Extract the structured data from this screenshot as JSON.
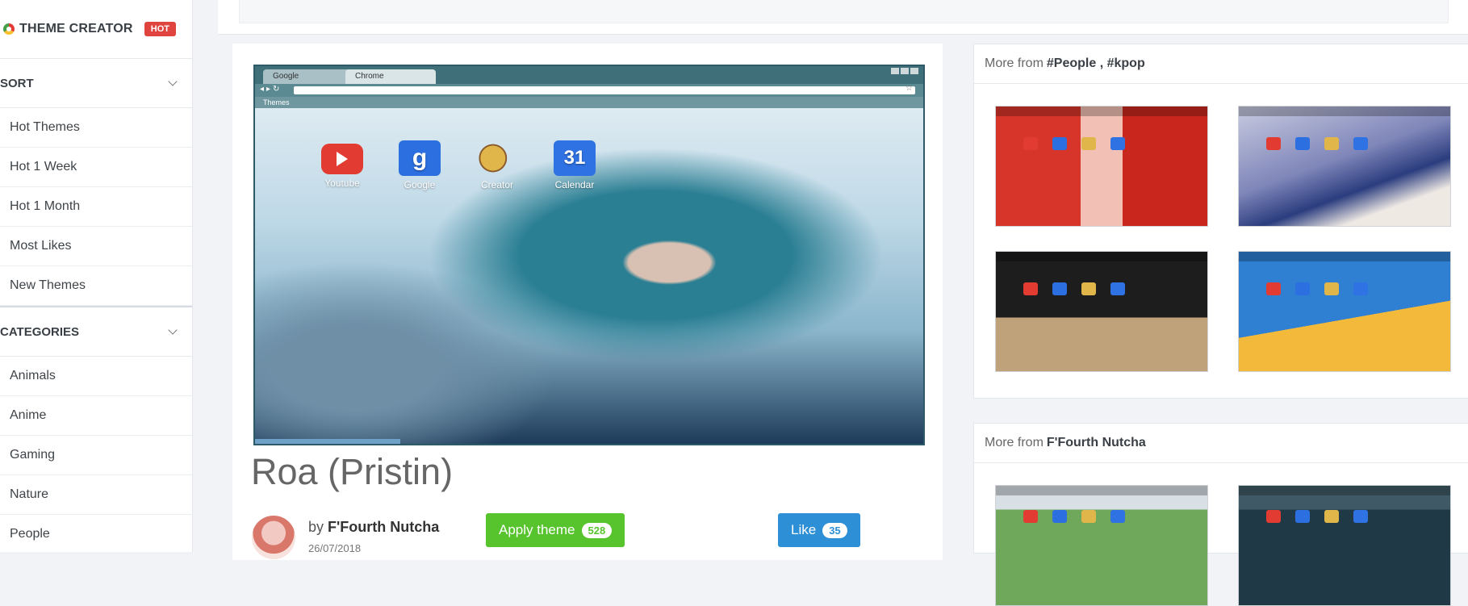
{
  "brand": {
    "title": "THEME CREATOR",
    "badge": "HOT"
  },
  "sidebar": {
    "sort_label": "SORT",
    "sort_items": [
      "Hot Themes",
      "Hot 1 Week",
      "Hot 1 Month",
      "Most Likes",
      "New Themes"
    ],
    "categories_label": "CATEGORIES",
    "category_items": [
      "Animals",
      "Anime",
      "Gaming",
      "Nature",
      "People"
    ]
  },
  "theme": {
    "title": "Roa (Pristin)",
    "by_prefix": "by",
    "author": "F'Fourth Nutcha",
    "date": "26/07/2018",
    "apply_label": "Apply theme",
    "apply_count": "528",
    "like_label": "Like",
    "like_count": "35"
  },
  "preview": {
    "tabs": [
      "Google",
      "Chrome"
    ],
    "bookmarks_label": "Themes",
    "apps": [
      "Youtube",
      "Google",
      "Creator",
      "Calendar"
    ],
    "google_glyph": "g",
    "calendar_glyph": "31"
  },
  "related_tags": {
    "prefix": "More from",
    "tags": "#People , #kpop"
  },
  "related_author": {
    "prefix": "More from",
    "author": "F'Fourth Nutcha"
  },
  "colors": {
    "apply": "#57c42e",
    "like": "#2d8fd5",
    "hot": "#e0443e",
    "accent_pointer": "#39b54a"
  }
}
